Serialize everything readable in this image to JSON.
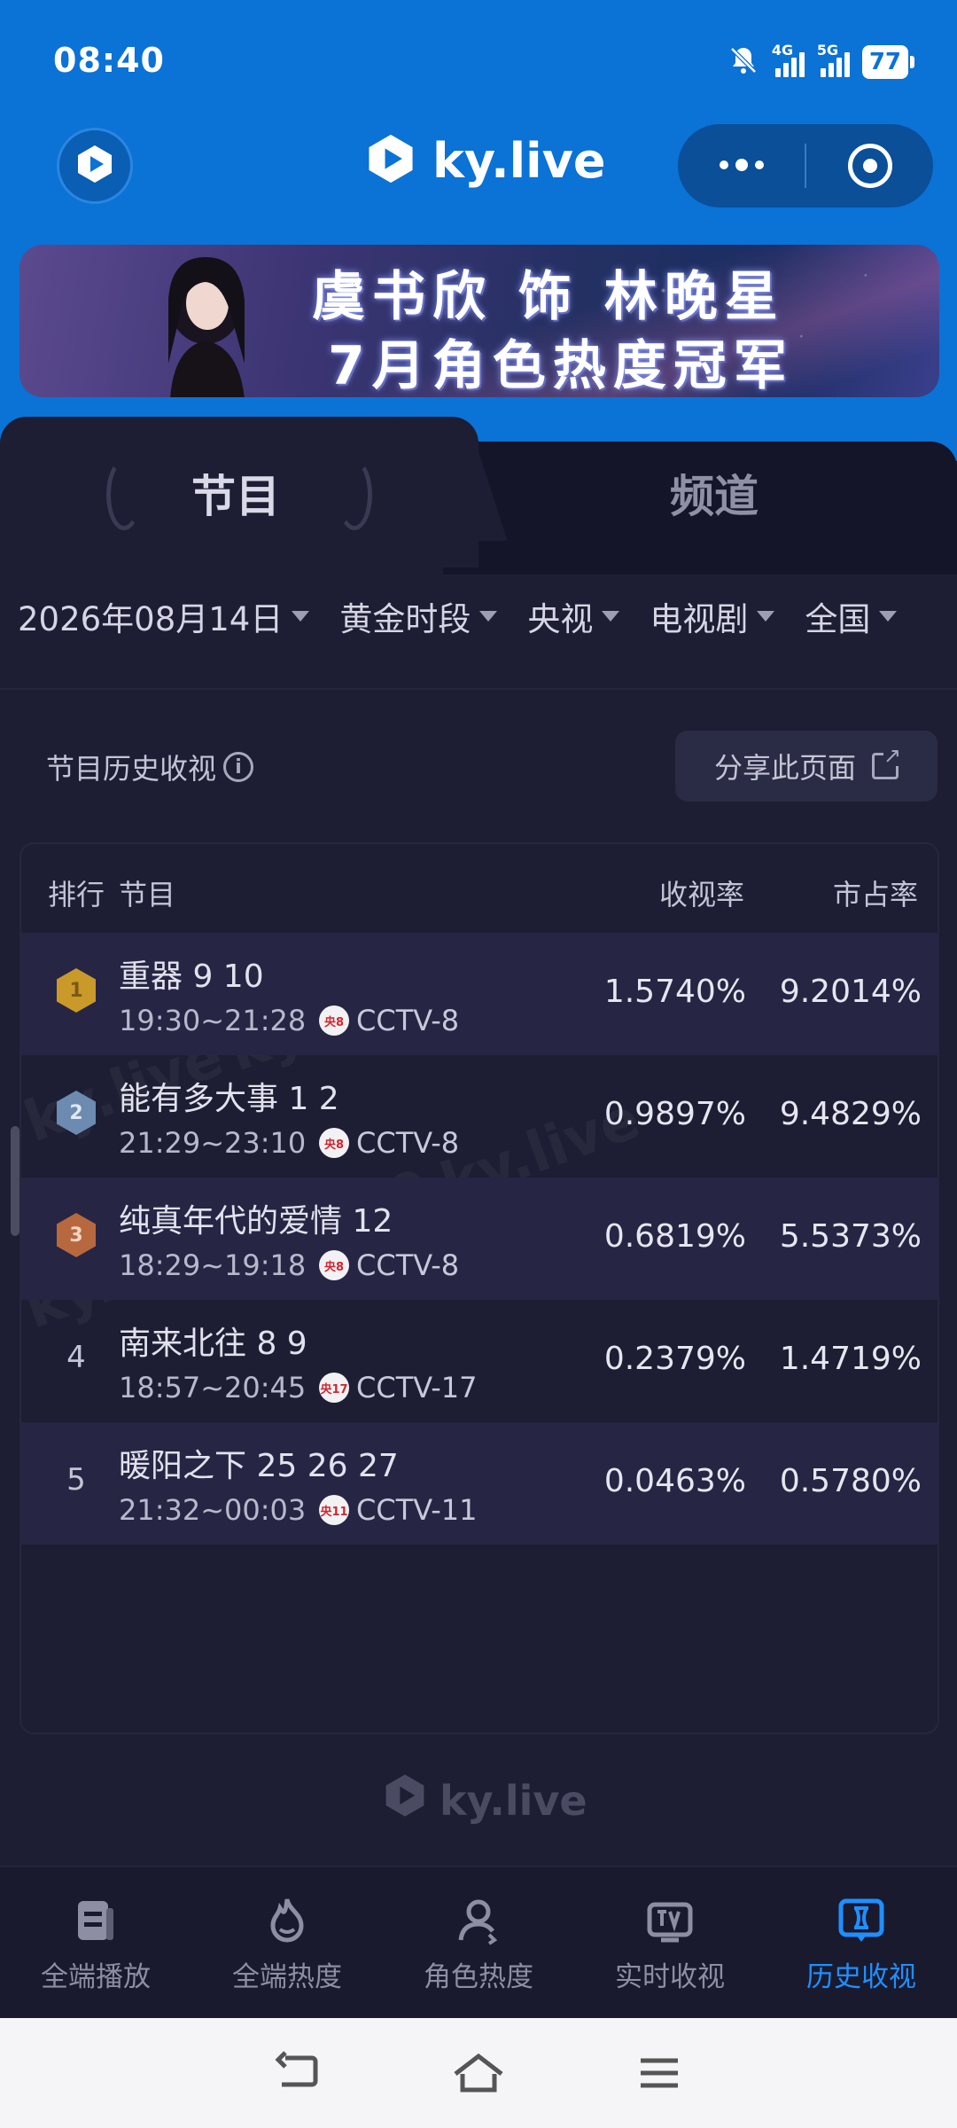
{
  "status": {
    "time": "08:40",
    "net1": "4G",
    "net2": "5G",
    "battery": "77"
  },
  "header": {
    "brand": "ky.live"
  },
  "banner": {
    "line1": "虞书欣 饰 林晚星",
    "line2": "7月角色热度冠军"
  },
  "tabs": [
    {
      "label": "节目",
      "active": true
    },
    {
      "label": "频道",
      "active": false
    }
  ],
  "filters": [
    {
      "label": "2026年08月14日"
    },
    {
      "label": "黄金时段"
    },
    {
      "label": "央视"
    },
    {
      "label": "电视剧"
    },
    {
      "label": "全国"
    }
  ],
  "section": {
    "title": "节目历史收视",
    "share_label": "分享此页面"
  },
  "table": {
    "headers": {
      "rank": "排行",
      "program": "节目",
      "rating": "收视率",
      "share": "市占率"
    },
    "rows": [
      {
        "rank": "1",
        "medal": "gold",
        "name": "重器 9 10",
        "time": "19:30~21:28",
        "channel_badge": "央8",
        "channel": "CCTV-8",
        "rating": "1.5740%",
        "share": "9.2014%"
      },
      {
        "rank": "2",
        "medal": "silver",
        "name": "能有多大事 1 2",
        "time": "21:29~23:10",
        "channel_badge": "央8",
        "channel": "CCTV-8",
        "rating": "0.9897%",
        "share": "9.4829%"
      },
      {
        "rank": "3",
        "medal": "bronze",
        "name": "纯真年代的爱情 12",
        "time": "18:29~19:18",
        "channel_badge": "央8",
        "channel": "CCTV-8",
        "rating": "0.6819%",
        "share": "5.5373%"
      },
      {
        "rank": "4",
        "medal": "",
        "name": "南来北往 8 9",
        "time": "18:57~20:45",
        "channel_badge": "央17",
        "channel": "CCTV-17",
        "rating": "0.2379%",
        "share": "1.4719%"
      },
      {
        "rank": "5",
        "medal": "",
        "name": "暖阳之下 25 26 27",
        "time": "21:32~00:03",
        "channel_badge": "央11",
        "channel": "CCTV-11",
        "rating": "0.0463%",
        "share": "0.5780%"
      }
    ]
  },
  "footer": {
    "brand": "ky.live"
  },
  "nav": [
    {
      "label": "全端播放",
      "icon": "play-list-icon"
    },
    {
      "label": "全端热度",
      "icon": "fire-icon"
    },
    {
      "label": "角色热度",
      "icon": "person-icon"
    },
    {
      "label": "实时收视",
      "icon": "tv-icon"
    },
    {
      "label": "历史收视",
      "icon": "history-icon",
      "active": true
    }
  ],
  "colors": {
    "accent": "#1f8fff",
    "header_bg": "#0b72d6",
    "page_bg": "#1d1d33",
    "gold": "#c99a2a",
    "silver": "#6d8bb0",
    "bronze": "#b8683e"
  }
}
